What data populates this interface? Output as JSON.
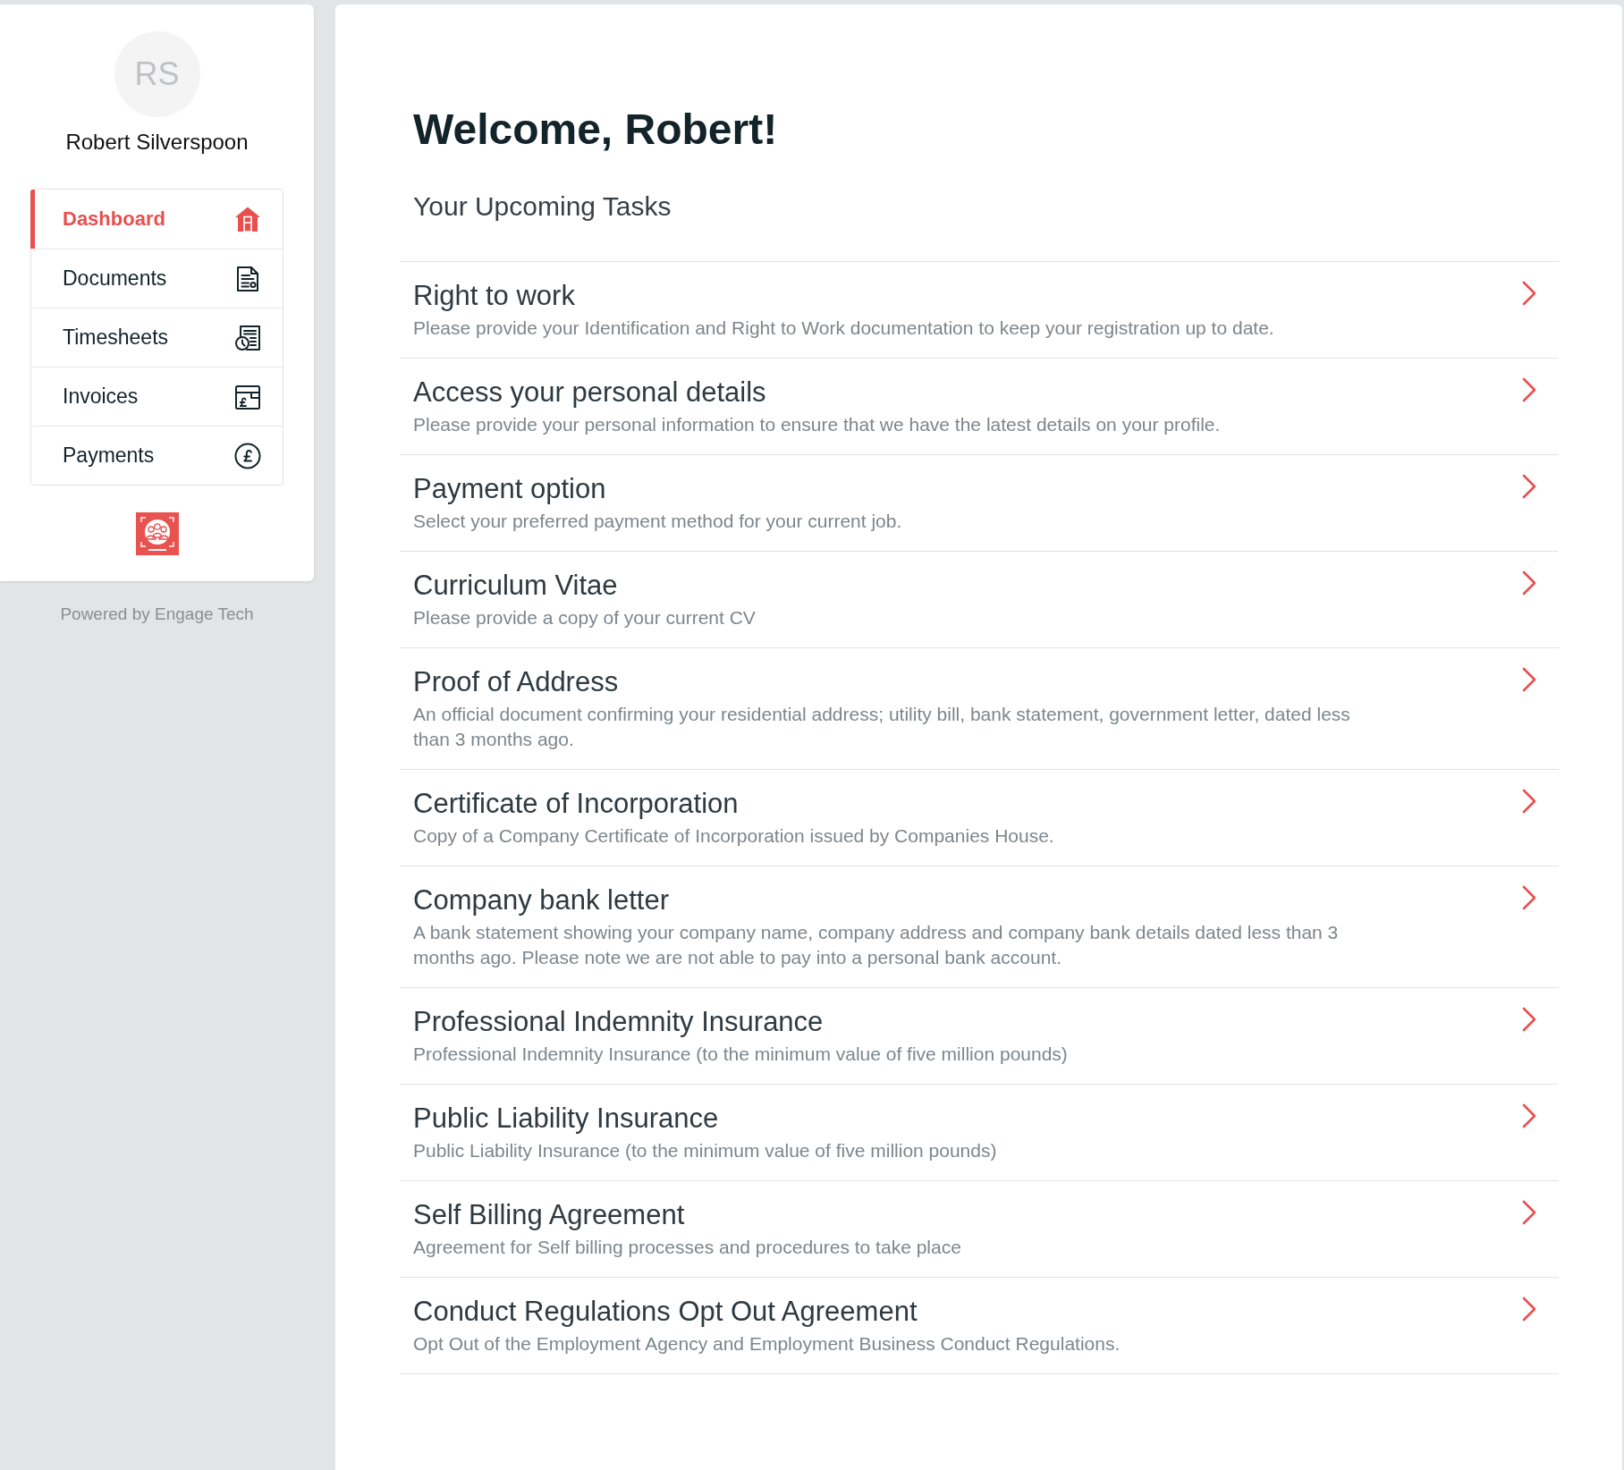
{
  "sidebar": {
    "avatar_initials": "RS",
    "user_name": "Robert Silverspoon",
    "nav": [
      {
        "label": "Dashboard",
        "selected": true
      },
      {
        "label": "Documents",
        "selected": false
      },
      {
        "label": "Timesheets",
        "selected": false
      },
      {
        "label": "Invoices",
        "selected": false
      },
      {
        "label": "Payments",
        "selected": false
      }
    ],
    "footer": "Powered by Engage Tech"
  },
  "main": {
    "title": "Welcome, Robert!",
    "subtitle": "Your Upcoming Tasks",
    "tasks": [
      {
        "title": "Right to work",
        "description": "Please provide your Identification and Right to Work documentation to keep your registration up to date."
      },
      {
        "title": "Access your personal details",
        "description": "Please provide your personal information to ensure that we have the latest details on your profile."
      },
      {
        "title": "Payment option",
        "description": "Select your preferred payment method for your current job."
      },
      {
        "title": "Curriculum Vitae",
        "description": "Please provide a copy of your current CV"
      },
      {
        "title": "Proof of Address",
        "description": "An official document confirming your residential address; utility bill, bank statement, government letter, dated less than 3 months ago."
      },
      {
        "title": "Certificate of Incorporation",
        "description": "Copy of a Company Certificate of Incorporation issued by Companies House."
      },
      {
        "title": "Company bank letter",
        "description": "A bank statement showing your company name, company address and company bank details dated less than 3 months ago. Please note we are not able to pay into a personal bank account."
      },
      {
        "title": "Professional Indemnity Insurance",
        "description": "Professional Indemnity Insurance (to the minimum value of five million pounds)"
      },
      {
        "title": "Public Liability Insurance",
        "description": "Public Liability Insurance (to the minimum value of five million pounds)"
      },
      {
        "title": "Self Billing Agreement",
        "description": "Agreement for Self billing processes and procedures to take place"
      },
      {
        "title": "Conduct Regulations Opt Out Agreement",
        "description": "Opt Out of the Employment Agency and Employment Business Conduct Regulations."
      }
    ]
  }
}
